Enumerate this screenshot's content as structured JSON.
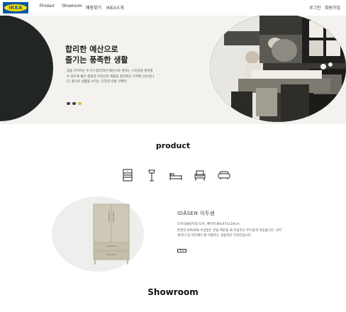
{
  "nav": {
    "logo_text": "IKEA",
    "links": [
      "Product",
      "Showroom",
      "매장찾기",
      "IKEA소개"
    ],
    "right": [
      "로그인",
      "회원가입"
    ]
  },
  "hero": {
    "title_line1": "합리한 예산으로",
    "title_line2": "즐기는 풍족한 생활",
    "desc": "집을 꾸미려는 누구나 합리적인 예산으로 원하는 스타일을 완성할 수 있도록 좋은 품질과 디자인의 제품을 합리적인 가격에 선보입니다. 즐거운 생활을 누리는 건강한 방법 이케아"
  },
  "product_section": {
    "title": "product",
    "icons": [
      "cabinet-icon",
      "floor-lamp-icon",
      "bed-icon",
      "armchair-icon",
      "sofa-icon"
    ]
  },
  "product_card": {
    "name": "IDÅSEN 이두센",
    "spec": "도어식슬라이딩 도어, 베이지 80x47x119cm",
    "desc": "튼튼한 IDÅSEN 수납장은 문을 여닫을 때 조용하고 부드럽게 작동합니다. 사무실이나 집 어디에나 잘 어울리는 실용적인 디자인입니다.",
    "button": "Buy"
  },
  "showroom_section": {
    "title": "Showroom"
  },
  "colors": {
    "ikea_blue": "#0058a3",
    "ikea_yellow": "#ffdb00",
    "hero_bg": "#f3f2ef",
    "dark_circle": "#212524",
    "cabinet": "#cfc8b6"
  }
}
